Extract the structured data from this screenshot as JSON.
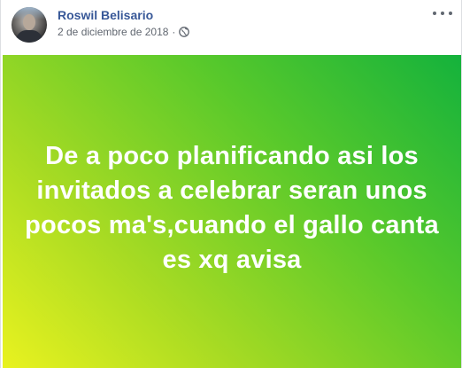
{
  "post": {
    "author_name": "Roswil Belisario",
    "date": "2 de diciembre de 2018",
    "separator": "·",
    "privacy_icon": "globe-icon",
    "more_icon": "more-options-icon",
    "background_colors": [
      "#14b23c",
      "#59c92b",
      "#a8db23",
      "#e9f21f"
    ],
    "text": "De a poco planificando asi los invitados a celebrar seran unos pocos ma's,cuando el gallo canta es xq avisa",
    "link_color": "#385898",
    "meta_color": "#616770"
  }
}
